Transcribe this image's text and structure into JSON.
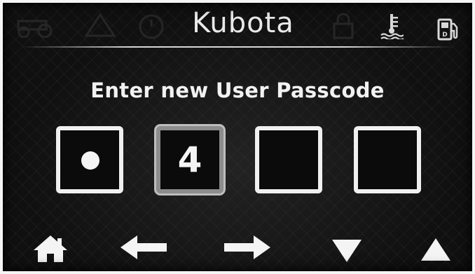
{
  "header": {
    "brand": "Kubota",
    "icons": {
      "left_faded": [
        "tractor-icon",
        "warning-icon",
        "timer-icon"
      ],
      "center_faded": "lock-icon",
      "coolant": "coolant-temperature-icon",
      "fuel": "fuel-pump-icon"
    }
  },
  "passcode": {
    "prompt": "Enter new User Passcode",
    "slots": [
      {
        "display": "masked",
        "value": "•"
      },
      {
        "display": "digit",
        "value": "4",
        "active": true
      },
      {
        "display": "empty",
        "value": ""
      },
      {
        "display": "empty",
        "value": ""
      }
    ]
  },
  "nav": {
    "buttons": [
      "home-icon",
      "arrow-left-icon",
      "arrow-right-icon",
      "triangle-down-icon",
      "triangle-up-icon"
    ]
  },
  "colors": {
    "background": "#101010",
    "foreground": "#f0f0f0",
    "active_border": "#8c8c8c"
  }
}
